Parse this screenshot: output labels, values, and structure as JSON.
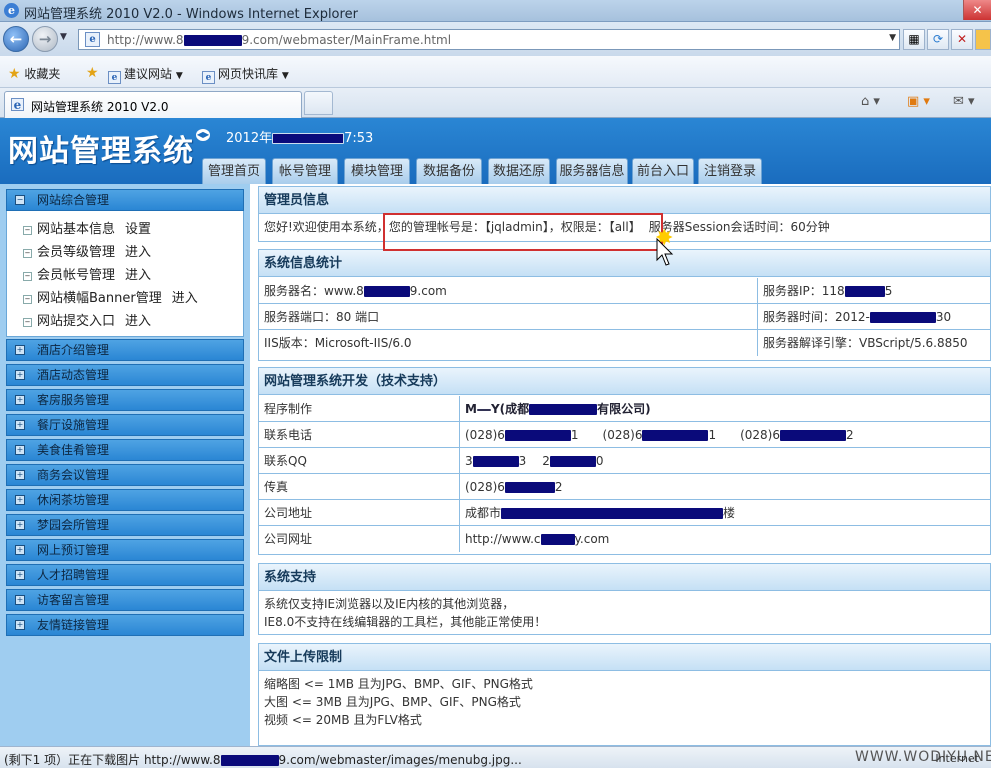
{
  "window": {
    "title": "网站管理系统 2010 V2.0 - Windows Internet Explorer"
  },
  "address": {
    "url_prefix": "http://www.8",
    "url_suffix": "9.com/webmaster/MainFrame.html"
  },
  "favorites": {
    "label": "收藏夹",
    "item1": "建议网站",
    "item2": "网页快讯库"
  },
  "tabs": {
    "active_title": "网站管理系统 2010 V2.0"
  },
  "site": {
    "logo": "网站管理系统",
    "time_prefix": "2012年",
    "time_suffix": "7:53",
    "nav": [
      "管理首页",
      "帐号管理",
      "模块管理",
      "数据备份",
      "数据还原",
      "服务器信息",
      "前台入口",
      "注销登录"
    ]
  },
  "sidebar": {
    "groups": [
      "网站综合管理",
      "酒店介绍管理",
      "酒店动态管理",
      "客房服务管理",
      "餐厅设施管理",
      "美食佳肴管理",
      "商务会议管理",
      "休闲茶坊管理",
      "梦园会所管理",
      "网上预订管理",
      "人才招聘管理",
      "访客留言管理",
      "友情链接管理"
    ],
    "sub_items": [
      {
        "label": "网站基本信息",
        "action": "设置"
      },
      {
        "label": "会员等级管理",
        "action": "进入"
      },
      {
        "label": "会员帐号管理",
        "action": "进入"
      },
      {
        "label": "网站横幅Banner管理",
        "action": "进入"
      },
      {
        "label": "网站提交入口",
        "action": "进入"
      }
    ]
  },
  "admin_info": {
    "heading": "管理员信息",
    "line_part1": "您好!欢迎使用本系统，",
    "line_part2": "您的管理帐号是：【jqladmin】，权限是：【all】",
    "line_part3": "服务器Session会话时间：60分钟"
  },
  "system_stats": {
    "heading": "系统信息统计",
    "server_name_label": "服务器名：www.8",
    "server_name_suffix": "9.com",
    "server_ip_label": "服务器IP：118",
    "server_ip_suffix": "5",
    "server_port": "服务器端口：80 端口",
    "server_time_label": "服务器时间：2012-",
    "server_time_suffix": "30",
    "iis_version": "IIS版本：Microsoft-IIS/6.0",
    "script_engine": "服务器解译引擎：VBScript/5.6.8850"
  },
  "dev": {
    "heading": "网站管理系统开发（技术支持）",
    "rows": [
      {
        "label": "程序制作",
        "value_a": "M",
        "value_b": "Y(成都",
        "value_c": "有限公司)"
      },
      {
        "label": "联系电话",
        "p1a": "(028)6",
        "p1b": "1",
        "p2a": "(028)6",
        "p2b": "1",
        "p3a": "(028)6",
        "p3b": "2"
      },
      {
        "label": "联系QQ",
        "q1a": "3",
        "q1b": "3",
        "q2a": "2",
        "q2b": "0"
      },
      {
        "label": "传真",
        "fa": "(028)6",
        "fb": "2"
      },
      {
        "label": "公司地址",
        "a1": "成都市",
        "a2": "楼"
      },
      {
        "label": "公司网址",
        "w1": "http://www.c",
        "w2": "y.com"
      }
    ]
  },
  "support": {
    "heading": "系统支持",
    "line1": "系统仅支持IE浏览器以及IE内核的其他浏览器，",
    "line2": "IE8.0不支持在线编辑器的工具栏，其他能正常使用！"
  },
  "upload": {
    "heading": "文件上传限制",
    "line1": "缩略图 <= 1MB 且为JPG、BMP、GIF、PNG格式",
    "line2": "大图 <= 3MB 且为JPG、BMP、GIF、PNG格式",
    "line3": "视频 <= 20MB 且为FLV格式"
  },
  "status": {
    "text_prefix": "(剩下1 项）正在下载图片 http://www.8",
    "text_suffix": "9.com/webmaster/images/menubg.jpg...",
    "watermark": "WWW.WODIYU.NET",
    "zone": "Internet"
  },
  "colors": {
    "header_blue": "#1a6cbe",
    "sidebar_bg": "#9fcdf0",
    "highlight_red": "#d03030"
  }
}
